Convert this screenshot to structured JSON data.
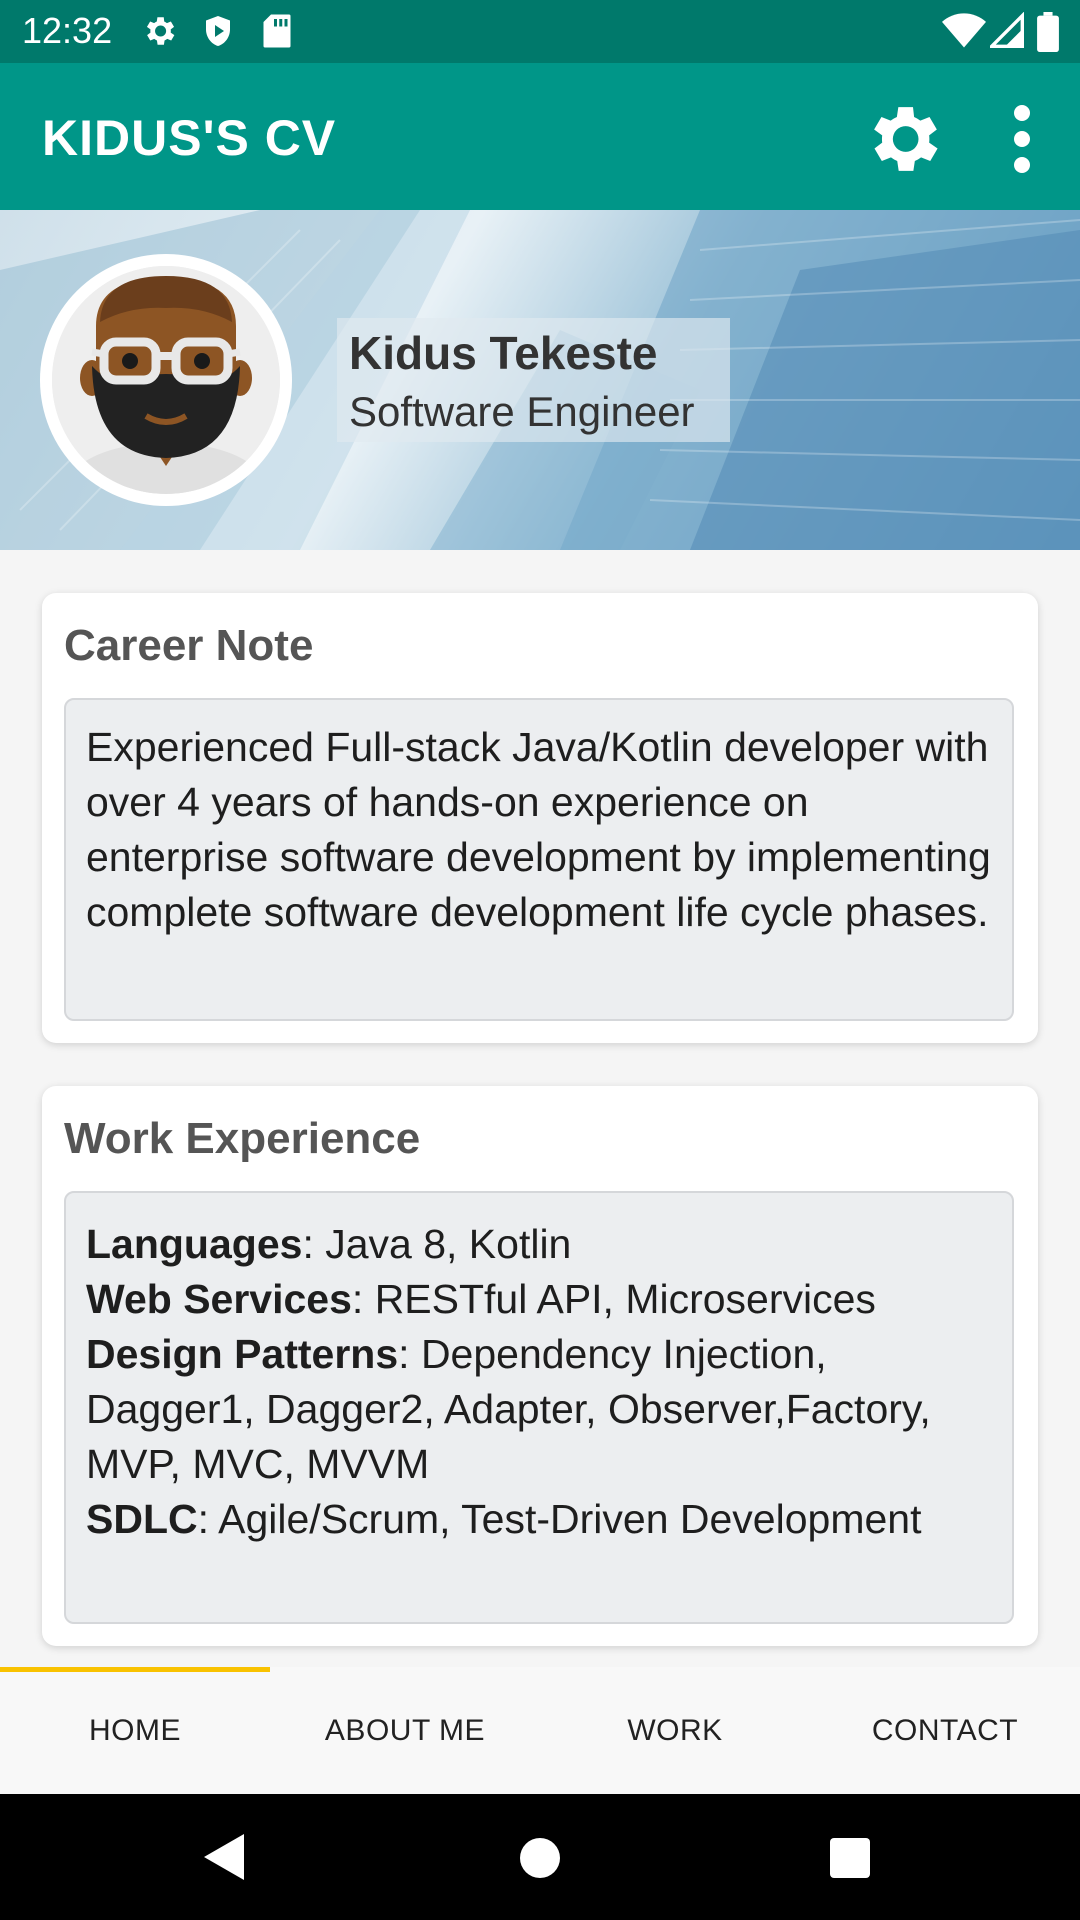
{
  "status_bar": {
    "time": "12:32",
    "icons": [
      "gear-icon",
      "shield-icon",
      "sd-card-icon",
      "wifi-icon",
      "signal-icon",
      "battery-icon"
    ]
  },
  "app_bar": {
    "title": "KIDUS'S CV",
    "actions": [
      "settings-icon",
      "more-vert-icon"
    ],
    "color": "#009688"
  },
  "profile": {
    "name": "Kidus Tekeste",
    "role": "Software Engineer"
  },
  "career_note": {
    "title": "Career Note",
    "text": "Experienced Full-stack Java/Kotlin developer with over 4 years of hands-on experience on enterprise software development by implementing complete software development life cycle phases."
  },
  "work_experience": {
    "title": "Work Experience",
    "items": [
      {
        "label": "Languages",
        "value": ": Java 8, Kotlin"
      },
      {
        "label": "Web Services",
        "value": ": RESTful API, Microservices"
      },
      {
        "label": "Design Patterns",
        "value": ": Dependency Injection, Dagger1, Dagger2, Adapter, Observer,Factory, MVP, MVC, MVVM"
      },
      {
        "label": "SDLC",
        "value": ": Agile/Scrum, Test-Driven Development"
      }
    ]
  },
  "tabs": {
    "items": [
      {
        "label": "HOME"
      },
      {
        "label": "ABOUT ME"
      },
      {
        "label": "WORK"
      },
      {
        "label": "CONTACT"
      }
    ],
    "selected": "HOME",
    "indicator_color": "#f9c200"
  },
  "nav_bar": {
    "buttons": [
      "back-icon",
      "home-icon",
      "recents-icon"
    ]
  }
}
